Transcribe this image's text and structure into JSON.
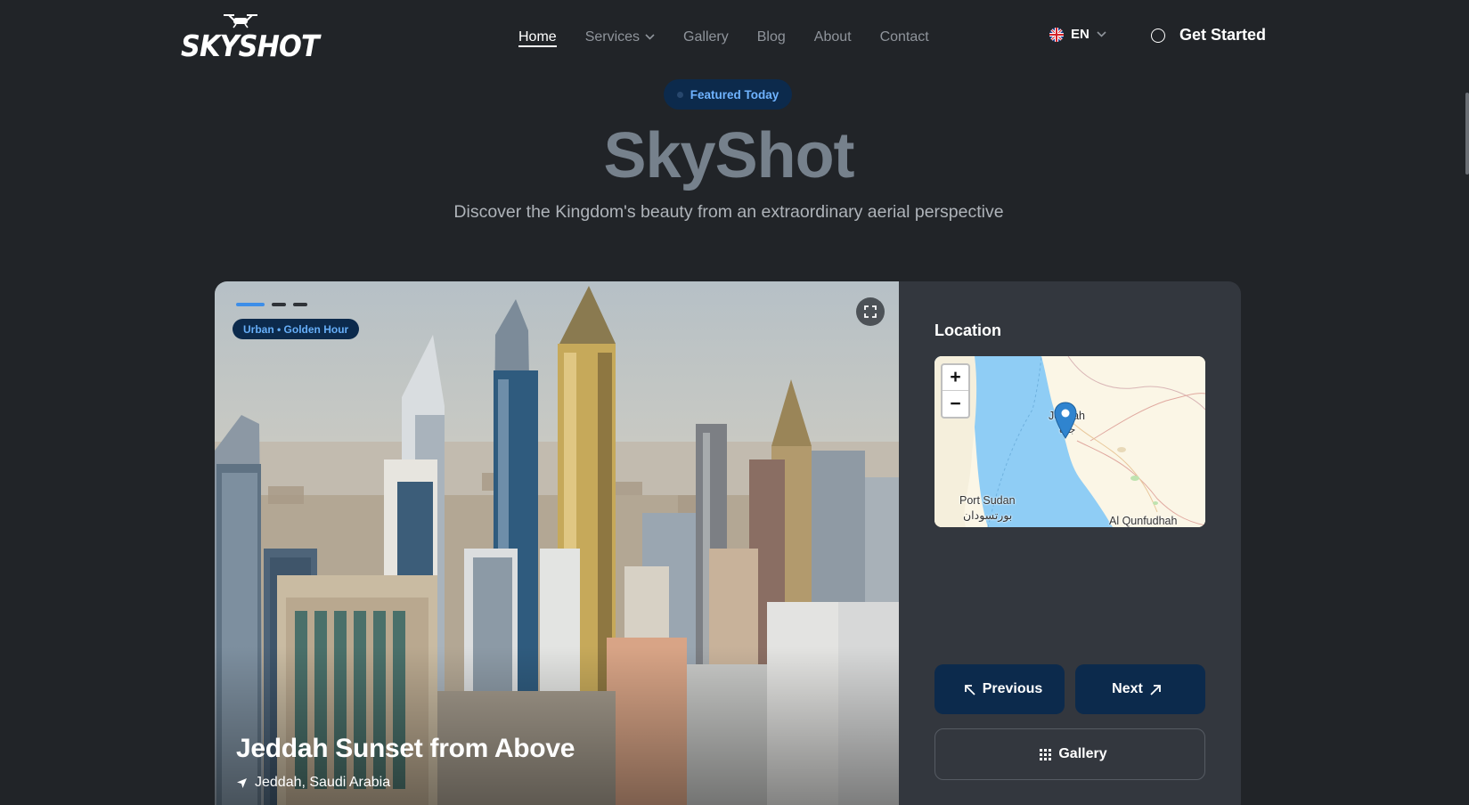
{
  "header": {
    "logo_text": "SKYSHOT",
    "nav": [
      {
        "label": "Home",
        "active": true
      },
      {
        "label": "Services",
        "has_dropdown": true
      },
      {
        "label": "Gallery"
      },
      {
        "label": "Blog"
      },
      {
        "label": "About"
      },
      {
        "label": "Contact"
      }
    ],
    "language": "EN",
    "cta_label": "Get Started"
  },
  "hero": {
    "badge": "Featured Today",
    "title": "SkyShot",
    "subtitle": "Discover the Kingdom's beauty from an extraordinary aerial perspective"
  },
  "featured": {
    "tag": "Urban • Golden Hour",
    "title": "Jeddah Sunset from Above",
    "location": "Jeddah, Saudi Arabia",
    "slides": 3,
    "active_slide": 1
  },
  "side": {
    "title": "Location",
    "map": {
      "zoom_in": "+",
      "zoom_out": "−",
      "labels": [
        "Jeddah",
        "Port Sudan",
        "بورتسودان",
        "Al Qunfudhah",
        "جدة"
      ]
    },
    "prev_label": "Previous",
    "next_label": "Next",
    "gallery_label": "Gallery"
  },
  "colors": {
    "background": "#212428",
    "card": "#33373e",
    "accent": "#0c2a4c",
    "accent_text": "#6fb3ff"
  }
}
